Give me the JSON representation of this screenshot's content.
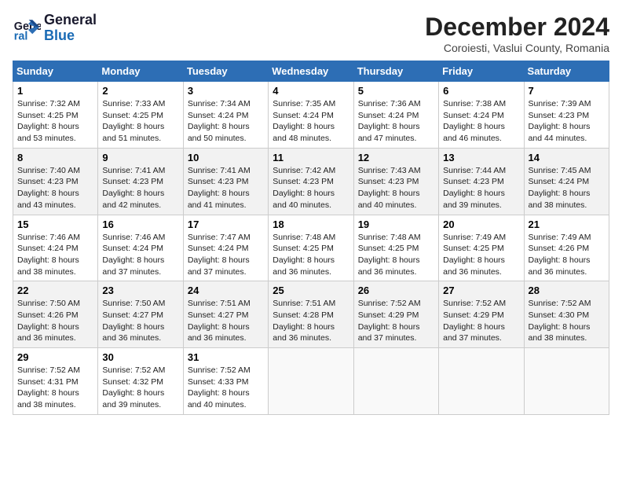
{
  "header": {
    "logo_line1": "General",
    "logo_line2": "Blue",
    "month": "December 2024",
    "location": "Coroiesti, Vaslui County, Romania"
  },
  "weekdays": [
    "Sunday",
    "Monday",
    "Tuesday",
    "Wednesday",
    "Thursday",
    "Friday",
    "Saturday"
  ],
  "weeks": [
    [
      {
        "day": "1",
        "sunrise": "7:32 AM",
        "sunset": "4:25 PM",
        "daylight": "8 hours and 53 minutes."
      },
      {
        "day": "2",
        "sunrise": "7:33 AM",
        "sunset": "4:25 PM",
        "daylight": "8 hours and 51 minutes."
      },
      {
        "day": "3",
        "sunrise": "7:34 AM",
        "sunset": "4:24 PM",
        "daylight": "8 hours and 50 minutes."
      },
      {
        "day": "4",
        "sunrise": "7:35 AM",
        "sunset": "4:24 PM",
        "daylight": "8 hours and 48 minutes."
      },
      {
        "day": "5",
        "sunrise": "7:36 AM",
        "sunset": "4:24 PM",
        "daylight": "8 hours and 47 minutes."
      },
      {
        "day": "6",
        "sunrise": "7:38 AM",
        "sunset": "4:24 PM",
        "daylight": "8 hours and 46 minutes."
      },
      {
        "day": "7",
        "sunrise": "7:39 AM",
        "sunset": "4:23 PM",
        "daylight": "8 hours and 44 minutes."
      }
    ],
    [
      {
        "day": "8",
        "sunrise": "7:40 AM",
        "sunset": "4:23 PM",
        "daylight": "8 hours and 43 minutes."
      },
      {
        "day": "9",
        "sunrise": "7:41 AM",
        "sunset": "4:23 PM",
        "daylight": "8 hours and 42 minutes."
      },
      {
        "day": "10",
        "sunrise": "7:41 AM",
        "sunset": "4:23 PM",
        "daylight": "8 hours and 41 minutes."
      },
      {
        "day": "11",
        "sunrise": "7:42 AM",
        "sunset": "4:23 PM",
        "daylight": "8 hours and 40 minutes."
      },
      {
        "day": "12",
        "sunrise": "7:43 AM",
        "sunset": "4:23 PM",
        "daylight": "8 hours and 40 minutes."
      },
      {
        "day": "13",
        "sunrise": "7:44 AM",
        "sunset": "4:23 PM",
        "daylight": "8 hours and 39 minutes."
      },
      {
        "day": "14",
        "sunrise": "7:45 AM",
        "sunset": "4:24 PM",
        "daylight": "8 hours and 38 minutes."
      }
    ],
    [
      {
        "day": "15",
        "sunrise": "7:46 AM",
        "sunset": "4:24 PM",
        "daylight": "8 hours and 38 minutes."
      },
      {
        "day": "16",
        "sunrise": "7:46 AM",
        "sunset": "4:24 PM",
        "daylight": "8 hours and 37 minutes."
      },
      {
        "day": "17",
        "sunrise": "7:47 AM",
        "sunset": "4:24 PM",
        "daylight": "8 hours and 37 minutes."
      },
      {
        "day": "18",
        "sunrise": "7:48 AM",
        "sunset": "4:25 PM",
        "daylight": "8 hours and 36 minutes."
      },
      {
        "day": "19",
        "sunrise": "7:48 AM",
        "sunset": "4:25 PM",
        "daylight": "8 hours and 36 minutes."
      },
      {
        "day": "20",
        "sunrise": "7:49 AM",
        "sunset": "4:25 PM",
        "daylight": "8 hours and 36 minutes."
      },
      {
        "day": "21",
        "sunrise": "7:49 AM",
        "sunset": "4:26 PM",
        "daylight": "8 hours and 36 minutes."
      }
    ],
    [
      {
        "day": "22",
        "sunrise": "7:50 AM",
        "sunset": "4:26 PM",
        "daylight": "8 hours and 36 minutes."
      },
      {
        "day": "23",
        "sunrise": "7:50 AM",
        "sunset": "4:27 PM",
        "daylight": "8 hours and 36 minutes."
      },
      {
        "day": "24",
        "sunrise": "7:51 AM",
        "sunset": "4:27 PM",
        "daylight": "8 hours and 36 minutes."
      },
      {
        "day": "25",
        "sunrise": "7:51 AM",
        "sunset": "4:28 PM",
        "daylight": "8 hours and 36 minutes."
      },
      {
        "day": "26",
        "sunrise": "7:52 AM",
        "sunset": "4:29 PM",
        "daylight": "8 hours and 37 minutes."
      },
      {
        "day": "27",
        "sunrise": "7:52 AM",
        "sunset": "4:29 PM",
        "daylight": "8 hours and 37 minutes."
      },
      {
        "day": "28",
        "sunrise": "7:52 AM",
        "sunset": "4:30 PM",
        "daylight": "8 hours and 38 minutes."
      }
    ],
    [
      {
        "day": "29",
        "sunrise": "7:52 AM",
        "sunset": "4:31 PM",
        "daylight": "8 hours and 38 minutes."
      },
      {
        "day": "30",
        "sunrise": "7:52 AM",
        "sunset": "4:32 PM",
        "daylight": "8 hours and 39 minutes."
      },
      {
        "day": "31",
        "sunrise": "7:52 AM",
        "sunset": "4:33 PM",
        "daylight": "8 hours and 40 minutes."
      },
      null,
      null,
      null,
      null
    ]
  ]
}
